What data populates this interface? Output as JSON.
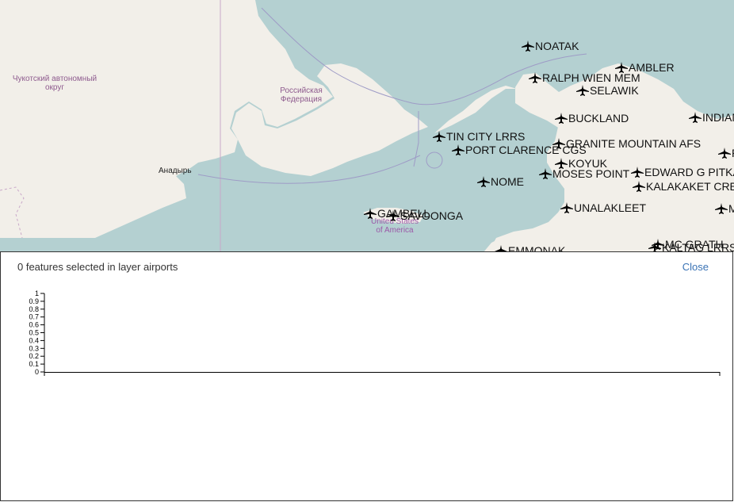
{
  "map": {
    "region_labels": {
      "chukotka": "Чукотский автономный\nокруг",
      "russia": "Российская\nФедерация",
      "anadyr": "Анадырь",
      "usa": "United States\nof America"
    },
    "airports": [
      {
        "id": "noatak",
        "name": "NOATAK"
      },
      {
        "id": "ambler",
        "name": "AMBLER"
      },
      {
        "id": "ralph-wien-mem",
        "name": "RALPH WIEN MEM"
      },
      {
        "id": "selawik",
        "name": "SELAWIK"
      },
      {
        "id": "buckland",
        "name": "BUCKLAND"
      },
      {
        "id": "indian",
        "name": "INDIAN"
      },
      {
        "id": "tin-city-lrrs",
        "name": "TIN CITY LRRS"
      },
      {
        "id": "granite-mountain-afs",
        "name": "GRANITE MOUNTAIN AFS"
      },
      {
        "id": "port-clarence-cgs",
        "name": "PORT CLARENCE CGS"
      },
      {
        "id": "koyuk",
        "name": "KOYUK"
      },
      {
        "id": "moses-point",
        "name": "MOSES POINT"
      },
      {
        "id": "edward-g-pitka",
        "name": "EDWARD G PITKA"
      },
      {
        "id": "kalakaket-creek",
        "name": "KALAKAKET CREE"
      },
      {
        "id": "nome",
        "name": "NOME"
      },
      {
        "id": "unalakleet",
        "name": "UNALAKLEET"
      },
      {
        "id": "gambell",
        "name": "GAMBELL"
      },
      {
        "id": "savoonga",
        "name": "SAVOONGA"
      },
      {
        "id": "emmonak",
        "name": "EMMONAK"
      },
      {
        "id": "mc-grath",
        "name": "MC GRATH"
      },
      {
        "id": "kaltag-lrrs",
        "name": "KALTAG LRRS"
      },
      {
        "id": "edge-r",
        "name": "R"
      },
      {
        "id": "edge-m",
        "name": "M"
      }
    ],
    "colors": {
      "water": "#b4d0d1",
      "land": "#f2efe9",
      "border": "#9e9bc6",
      "plane": "#000000"
    }
  },
  "panel": {
    "title": "0 features selected in layer airports",
    "close_label": "Close"
  },
  "chart_data": {
    "type": "bar",
    "categories": [],
    "values": [],
    "title": "",
    "xlabel": "",
    "ylabel": "",
    "ylim": [
      0,
      1
    ],
    "yticks": [
      "0",
      "0.1",
      "0.2",
      "0.3",
      "0.4",
      "0.5",
      "0.6",
      "0.7",
      "0.8",
      "0.9",
      "1"
    ]
  }
}
